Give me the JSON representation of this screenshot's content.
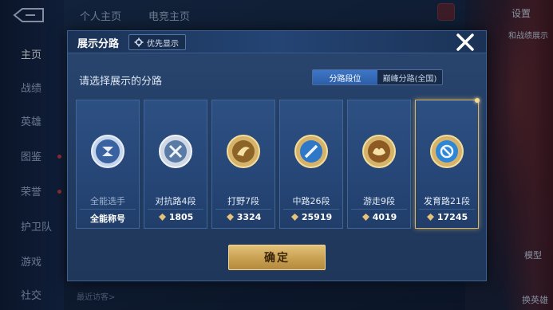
{
  "background": {
    "nav": [
      {
        "label": "主页",
        "active": true
      },
      {
        "label": "战绩",
        "active": false
      },
      {
        "label": "英雄",
        "active": false
      },
      {
        "label": "图鉴",
        "active": false
      },
      {
        "label": "荣誉",
        "active": false
      },
      {
        "label": "护卫队",
        "active": false
      },
      {
        "label": "游戏",
        "active": false
      },
      {
        "label": "社交",
        "active": false
      }
    ],
    "tabs": [
      "个人主页",
      "电竞主页"
    ],
    "settings_label": "设置",
    "right_link": "和战绩展示",
    "model_label": "模型",
    "skin_label": "换英雄",
    "bottom_text": "最近访客>"
  },
  "modal": {
    "title": "展示分路",
    "priority_label": "优先显示",
    "prompt": "请选择展示的分路",
    "segments": [
      {
        "label": "分路段位",
        "active": true
      },
      {
        "label": "巅峰分路(全国)",
        "active": false
      }
    ],
    "cards": [
      {
        "name": "全能选手",
        "score": "全能称号",
        "selected": false,
        "badge": "all-round-badge-icon",
        "dim": true
      },
      {
        "name": "对抗路4段",
        "score": "1805",
        "selected": false,
        "badge": "clash-lane-badge-icon",
        "dim": false
      },
      {
        "name": "打野7段",
        "score": "3324",
        "selected": false,
        "badge": "jungle-badge-icon",
        "dim": false
      },
      {
        "name": "中路26段",
        "score": "25919",
        "selected": false,
        "badge": "mid-lane-badge-icon",
        "dim": false
      },
      {
        "name": "游走9段",
        "score": "4019",
        "selected": false,
        "badge": "roam-badge-icon",
        "dim": false
      },
      {
        "name": "发育路21段",
        "score": "17245",
        "selected": true,
        "badge": "farm-lane-badge-icon",
        "dim": false
      }
    ],
    "confirm_label": "确定"
  },
  "colors": {
    "accent_gold": "#d8b466",
    "segment_active": "#3f77c6",
    "card_bg": "#2d5082"
  }
}
